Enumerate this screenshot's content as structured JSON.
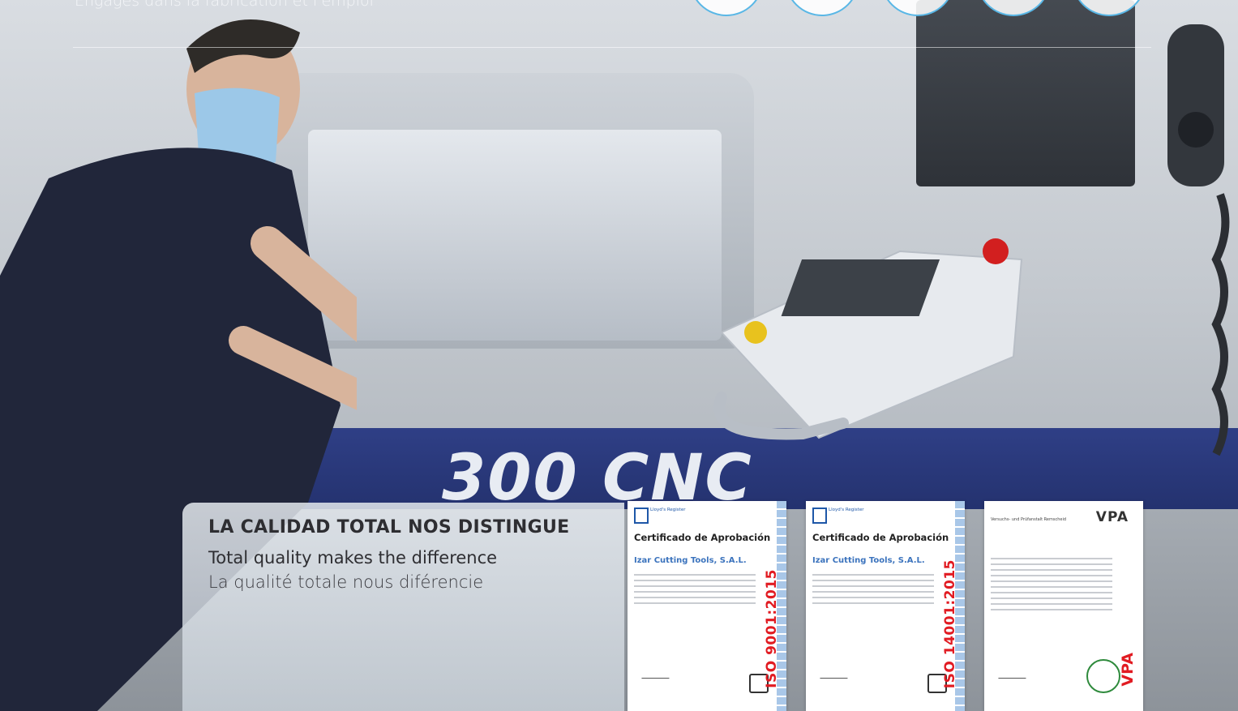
{
  "banner": {
    "top_line": "Engagés dans la fabrication et l'emploi",
    "machine_label": "300 CNC"
  },
  "quality": {
    "title": "LA CALIDAD TOTAL NOS DISTINGUE",
    "subtitle_en": "Total quality makes the difference",
    "subtitle_fr": "La qualité totale nous diférencie"
  },
  "certificates": [
    {
      "name": "iso-9001",
      "title": "Certificado de Aprobación",
      "company": "Izar Cutting Tools, S.A.L.",
      "standard": "ISO 9001:2015",
      "issuer": "Lloyd's Register"
    },
    {
      "name": "iso-14001",
      "title": "Certificado de Aprobación",
      "company": "Izar Cutting Tools, S.A.L.",
      "standard": "ISO 14001:2015",
      "issuer": "Lloyd's Register"
    },
    {
      "name": "vpa",
      "logo": "VPA",
      "header": "Versuchs- und Prüfanstalt Remscheid",
      "standard": "VPA"
    }
  ],
  "colors": {
    "accent_blue": "#59b7e6",
    "cert_red": "#e11b22",
    "lr_blue": "#1e57a8",
    "stripe_blue": "#2f3f86"
  }
}
